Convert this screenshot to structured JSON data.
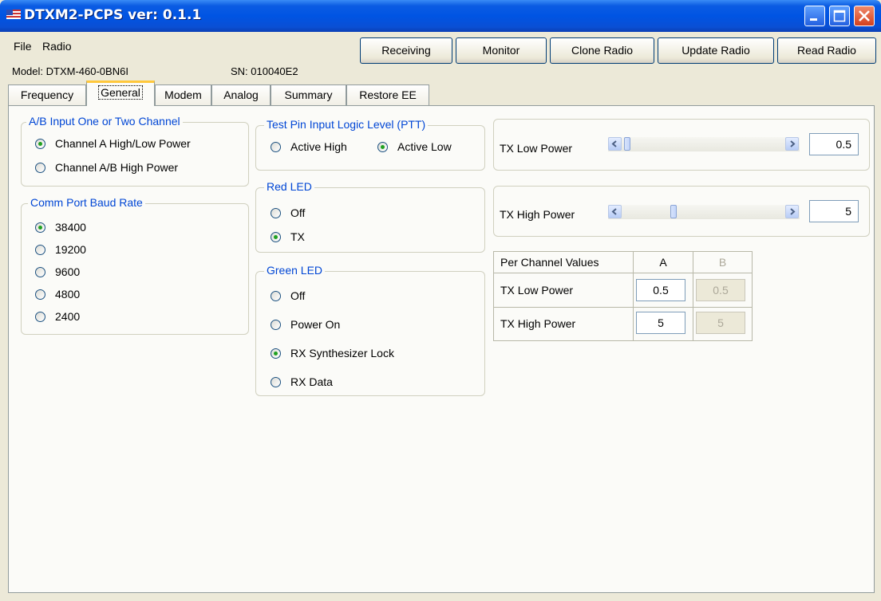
{
  "window": {
    "title": "DTXM2-PCPS ver: 0.1.1"
  },
  "menu": {
    "file": "File",
    "radio": "Radio"
  },
  "toolbar": {
    "receiving": "Receiving",
    "monitor": "Monitor",
    "clone": "Clone Radio",
    "update": "Update Radio",
    "read": "Read Radio"
  },
  "info": {
    "model": "Model: DTXM-460-0BN6I",
    "sn": "SN: 010040E2"
  },
  "tabs": [
    "Frequency",
    "General",
    "Modem",
    "Analog",
    "Summary",
    "Restore EE"
  ],
  "active_tab": "General",
  "ab_input": {
    "title": "A/B Input One or Two Channel",
    "options": [
      "Channel A High/Low Power",
      "Channel A/B High Power"
    ],
    "selected": "Channel A High/Low Power"
  },
  "baud": {
    "title": "Comm Port Baud Rate",
    "options": [
      "38400",
      "19200",
      "9600",
      "4800",
      "2400"
    ],
    "selected": "38400"
  },
  "test_pin": {
    "title": "Test Pin Input Logic Level (PTT)",
    "options": [
      "Active High",
      "Active Low"
    ],
    "selected": "Active Low"
  },
  "red_led": {
    "title": "Red LED",
    "options": [
      "Off",
      "TX"
    ],
    "selected": "TX"
  },
  "green_led": {
    "title": "Green LED",
    "options": [
      "Off",
      "Power On",
      "RX Synthesizer Lock",
      "RX Data"
    ],
    "selected": "RX Synthesizer Lock"
  },
  "tx_low": {
    "label": "TX Low Power",
    "value": "0.5",
    "level": 0.0
  },
  "tx_high": {
    "label": "TX High Power",
    "value": "5",
    "level": 0.3
  },
  "per_channel": {
    "header": "Per Channel Values",
    "col_a": "A",
    "col_b": "B",
    "rows": [
      {
        "label": "TX Low Power",
        "a": "0.5",
        "b": "0.5"
      },
      {
        "label": "TX High Power",
        "a": "5",
        "b": "5"
      }
    ]
  }
}
